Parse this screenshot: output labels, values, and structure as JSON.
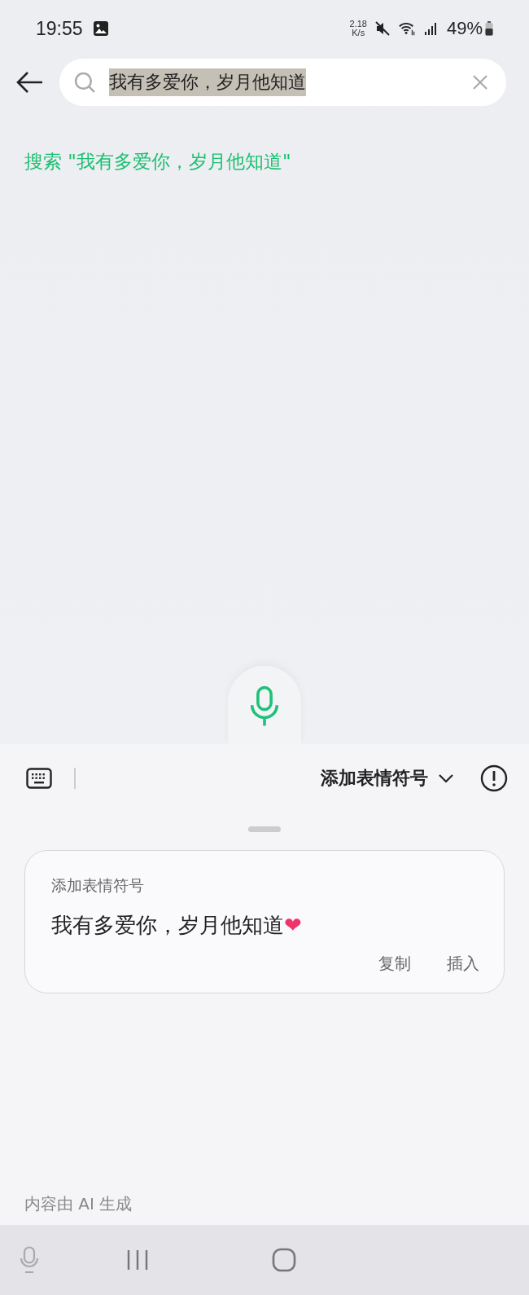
{
  "status_bar": {
    "time": "19:55",
    "net_speed": "2.18",
    "net_unit": "K/s",
    "battery": "49%"
  },
  "search": {
    "value": "我有多爱你，岁月他知道",
    "text_selected": true
  },
  "suggestion": "搜索 \"我有多爱你，岁月他知道\"",
  "toolbar": {
    "mode": "添加表情符号"
  },
  "result_card": {
    "title": "添加表情符号",
    "text": "我有多爱你，岁月他知道",
    "emoji": "❤",
    "actions": [
      "复制",
      "插入"
    ]
  },
  "footer_note": "内容由 AI 生成"
}
